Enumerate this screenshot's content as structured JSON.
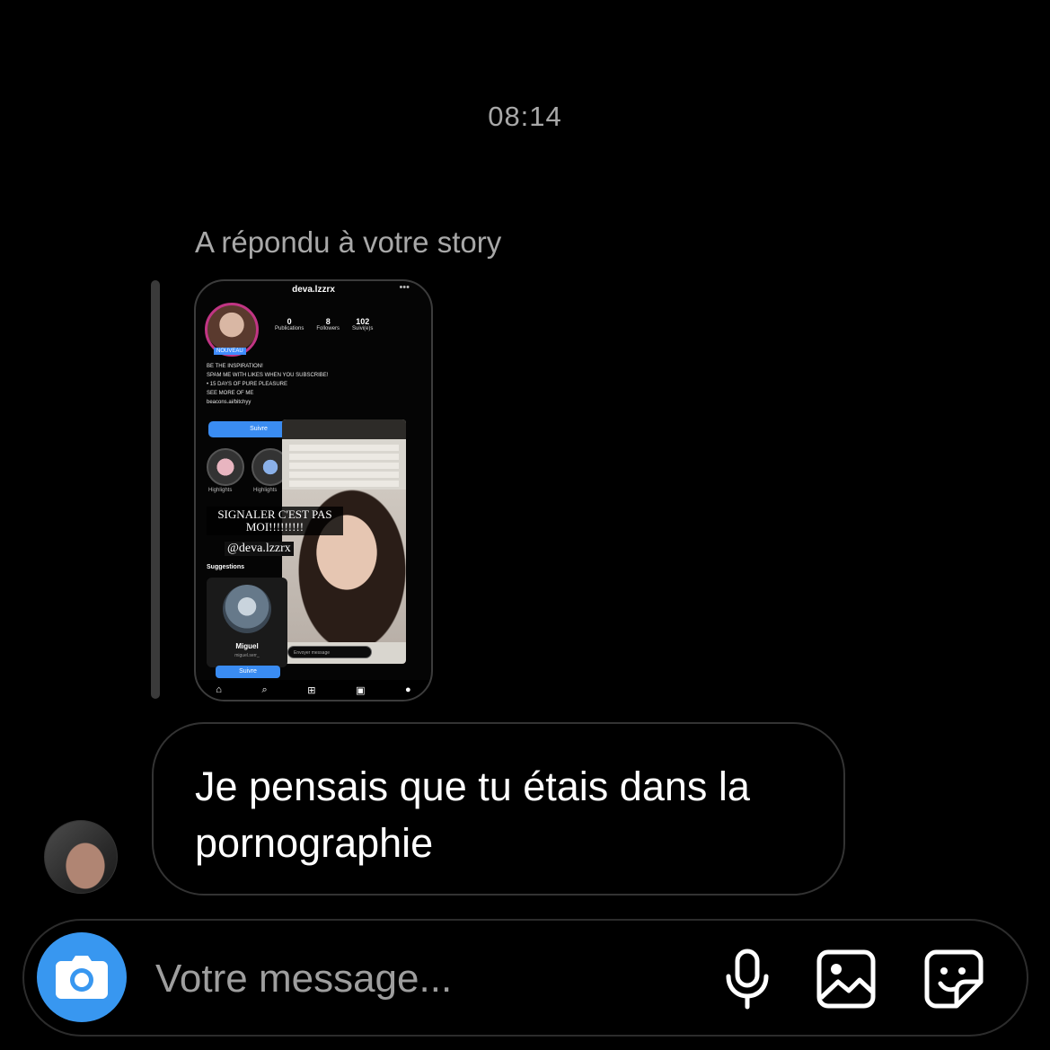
{
  "conversation": {
    "timestamp": "08:14",
    "reply_label": "A répondu à votre story",
    "story_preview": {
      "username": "deva.lzzrx",
      "stats": [
        {
          "value": "0",
          "label": "Publications"
        },
        {
          "value": "8",
          "label": "Followers"
        },
        {
          "value": "102",
          "label": "Suivi(e)s"
        }
      ],
      "badge": "NOUVEAU",
      "bio": [
        "BE THE INSPIRATION!",
        "SPAM ME WITH LIKES WHEN YOU SUBSCRIBE!",
        "• 15 DAYS OF PURE PLEASURE",
        "SEE MORE OF ME",
        "beacons.ai/bitchyy"
      ],
      "follow_label": "Suivre",
      "highlight_label": "Highlights",
      "overlay_caption": "SIGNALER C'EST PAS MOI!!!!!!!!!",
      "overlay_handle": "@deva.lzzrx",
      "suggestions_label": "Suggestions",
      "suggestion_name": "Miguel",
      "suggestion_sub": "miguel.serr_",
      "message_placeholder": "Envoyer message"
    },
    "message_text": "Je pensais que tu étais dans la pornographie"
  },
  "composer": {
    "placeholder": "Votre message..."
  },
  "icons": {
    "camera": "camera-icon",
    "mic": "microphone-icon",
    "gallery": "gallery-icon",
    "sticker": "sticker-icon"
  },
  "colors": {
    "background": "#000000",
    "accent": "#3897f0",
    "muted_text": "#a8a8a8",
    "bubble_border": "#333333"
  }
}
